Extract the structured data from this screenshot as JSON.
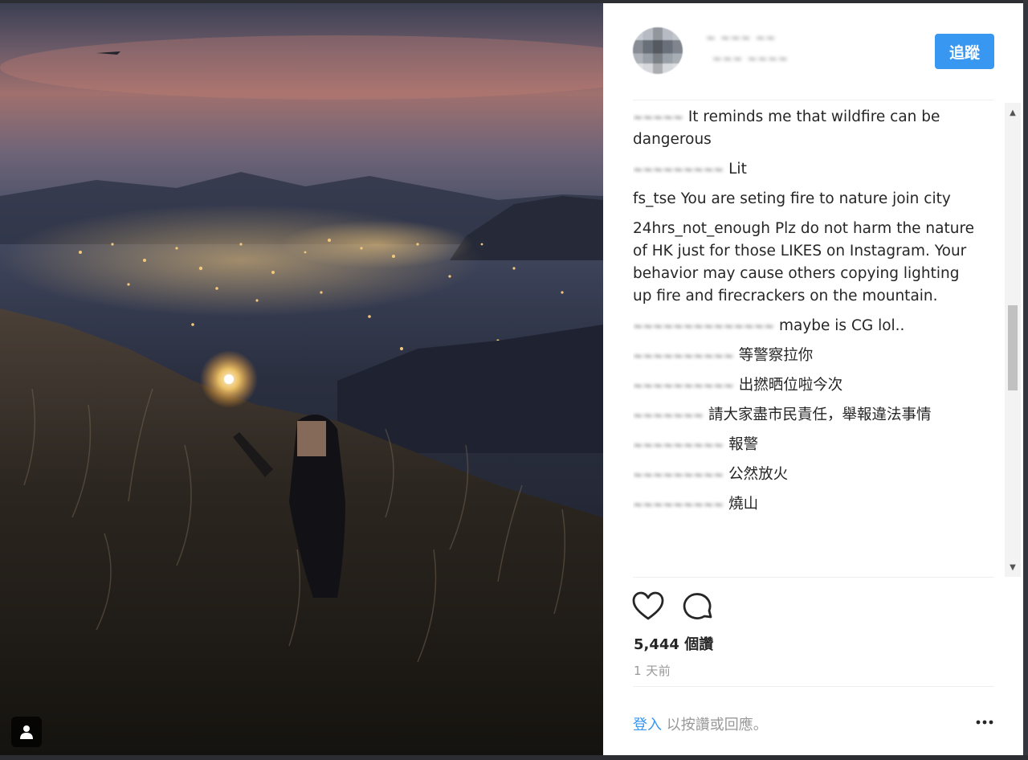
{
  "header": {
    "username": "~ ~~~ ~~",
    "location": "~~~ ~~~~",
    "follow_label": "追蹤"
  },
  "comments": [
    {
      "user": "~~~~~",
      "user_blurred": true,
      "text": "It reminds me that wildfire can be dangerous"
    },
    {
      "user": "~~~~~~~~~",
      "user_blurred": true,
      "text": "Lit"
    },
    {
      "user": "fs_tse",
      "user_blurred": false,
      "text": "You are seting fire to nature join city"
    },
    {
      "user": "24hrs_not_enough",
      "user_blurred": false,
      "text": "Plz do not harm the nature of HK just for those LIKES on Instagram. Your behavior may cause others copying lighting up fire and firecrackers on the mountain."
    },
    {
      "user": "~~~~~~~~~~~~~~",
      "user_blurred": true,
      "text": "maybe is CG lol.."
    },
    {
      "user": "~~~~~~~~~~",
      "user_blurred": true,
      "text": "等警察拉你"
    },
    {
      "user": "~~~~~~~~~~",
      "user_blurred": true,
      "text": "出撚晒位啦今次"
    },
    {
      "user": "~~~~~~~",
      "user_blurred": true,
      "text": "請大家盡市民責任，舉報違法事情"
    },
    {
      "user": "~~~~~~~~~",
      "user_blurred": true,
      "text": "報警"
    },
    {
      "user": "~~~~~~~~~",
      "user_blurred": true,
      "text": "公然放火"
    },
    {
      "user": "~~~~~~~~~",
      "user_blurred": true,
      "text": "燒山"
    }
  ],
  "actions": {
    "like_icon": "heart-outline-icon",
    "comment_icon": "speech-bubble-icon"
  },
  "likes_text": "5,444 個讚",
  "time_ago": "1 天前",
  "footer": {
    "login_link": "登入",
    "login_suffix": "以按讚或回應。",
    "more_icon": "ellipsis-icon"
  },
  "colors": {
    "accent": "#3897f0",
    "text": "#262626",
    "muted": "#999999"
  }
}
